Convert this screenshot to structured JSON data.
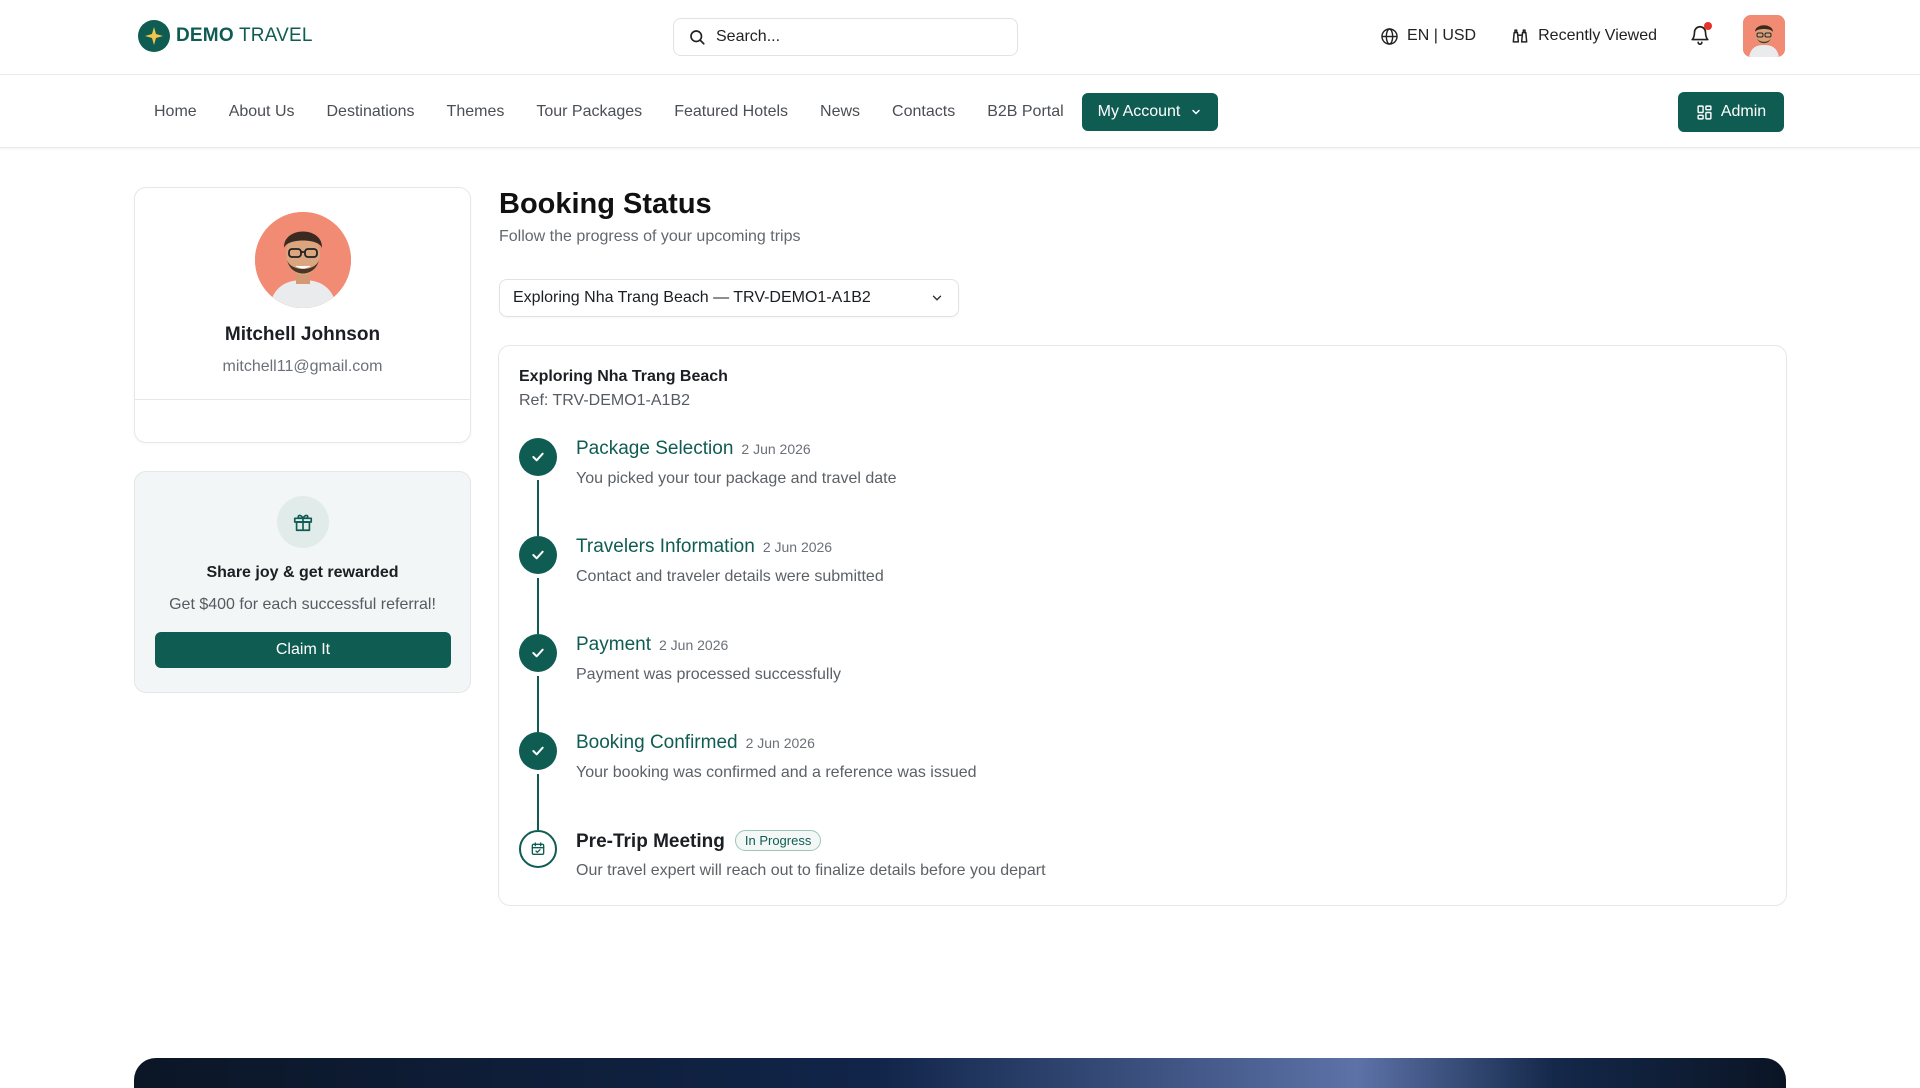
{
  "brand": {
    "name_bold": "DEMO",
    "name_light": "TRAVEL"
  },
  "search": {
    "placeholder": "Search..."
  },
  "topbar": {
    "locale": "EN | USD",
    "recently_viewed": "Recently Viewed"
  },
  "nav": {
    "items": [
      "Home",
      "About Us",
      "Destinations",
      "Themes",
      "Tour Packages",
      "Featured Hotels",
      "News",
      "Contacts",
      "B2B Portal"
    ],
    "active": "My Account",
    "admin": "Admin"
  },
  "profile": {
    "name": "Mitchell Johnson",
    "email": "mitchell11@gmail.com"
  },
  "referral": {
    "title": "Share joy & get rewarded",
    "subtitle": "Get $400 for each successful referral!",
    "button": "Claim It"
  },
  "page": {
    "title": "Booking Status",
    "subtitle": "Follow the progress of your upcoming trips"
  },
  "booking_select": {
    "value": "Exploring Nha Trang Beach — TRV-DEMO1-A1B2"
  },
  "trip": {
    "name": "Exploring Nha Trang Beach",
    "ref": "Ref: TRV-DEMO1-A1B2"
  },
  "steps": [
    {
      "title": "Package Selection",
      "date": "2 Jun 2026",
      "desc": "You picked your tour package and travel date"
    },
    {
      "title": "Travelers Information",
      "date": "2 Jun 2026",
      "desc": "Contact and traveler details were submitted"
    },
    {
      "title": "Payment",
      "date": "2 Jun 2026",
      "desc": "Payment was processed successfully"
    },
    {
      "title": "Booking Confirmed",
      "date": "2 Jun 2026",
      "desc": "Your booking was confirmed and a reference was issued"
    },
    {
      "title": "Pre-Trip Meeting",
      "badge": "In Progress",
      "desc": "Our travel expert will reach out to finalize details before you depart"
    }
  ],
  "colors": {
    "primary": "#0f5c52",
    "notification": "#e5332a",
    "avatar_bg": "#f28b74"
  }
}
